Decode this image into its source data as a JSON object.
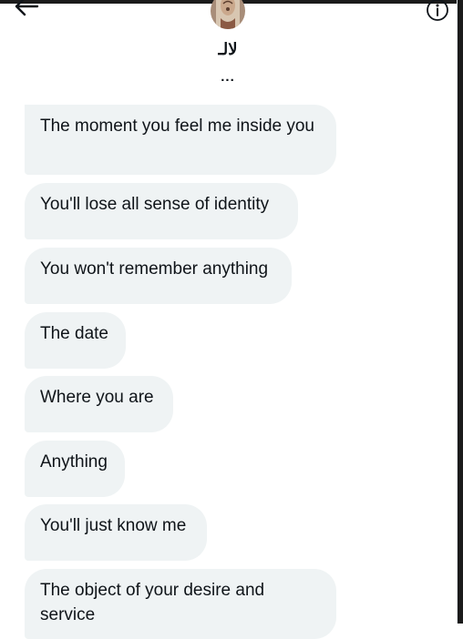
{
  "header": {
    "contact_name": "لالـ",
    "contact_handle": "...",
    "back_icon": "arrow-left-icon",
    "info_icon": "info-icon"
  },
  "messages": [
    {
      "text": "The moment you feel me inside you"
    },
    {
      "text": "You'll lose all sense of identity"
    },
    {
      "text": "You won't remember anything"
    },
    {
      "text": "The date"
    },
    {
      "text": "Where you are"
    },
    {
      "text": "Anything"
    },
    {
      "text": "You'll just know me"
    },
    {
      "text": "The object of your desire and service"
    }
  ],
  "colors": {
    "bubble_bg": "#eff3f4",
    "text": "#0f1419",
    "background": "#ffffff"
  }
}
